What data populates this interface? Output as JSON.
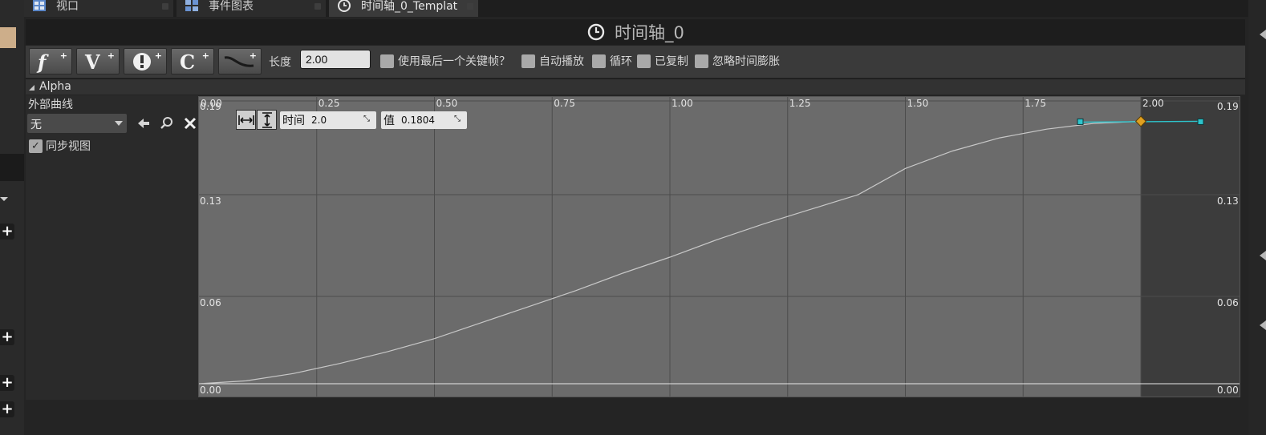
{
  "tabs": [
    {
      "label": "视口",
      "icon": "viewport-grid-icon"
    },
    {
      "label": "事件图表",
      "icon": "event-graph-icon"
    },
    {
      "label": "时间轴_0_Templat",
      "icon": "clock-icon",
      "active": true
    }
  ],
  "panel": {
    "title": "时间轴_0",
    "title_icon": "clock-icon"
  },
  "toolbar": {
    "buttons": [
      {
        "name": "add-float-track",
        "glyph": "f",
        "icon": "float-track-icon"
      },
      {
        "name": "add-vector-track",
        "glyph": "V",
        "icon": "vector-track-icon"
      },
      {
        "name": "add-event-track",
        "glyph": "!",
        "icon": "event-track-icon"
      },
      {
        "name": "add-color-track",
        "glyph": "C",
        "icon": "color-track-icon"
      },
      {
        "name": "add-curve-asset",
        "glyph": "~",
        "icon": "curve-asset-icon"
      }
    ],
    "length_label": "长度",
    "length_value": "2.00",
    "checkboxes": [
      {
        "label": "使用最后一个关键帧？",
        "checked": false
      },
      {
        "label": "自动播放",
        "checked": false
      },
      {
        "label": "循环",
        "checked": false
      },
      {
        "label": "已复制",
        "checked": false
      },
      {
        "label": "忽略时间膨胀",
        "checked": false
      }
    ]
  },
  "track": {
    "name": "Alpha",
    "external_curve_label": "外部曲线",
    "external_curve_value": "无",
    "sync_view_label": "同步视图",
    "sync_view_checked": true
  },
  "curve_editor": {
    "time_label": "时间",
    "time_value": "2.0",
    "value_label": "值",
    "value_value": "0.1804",
    "accent_color": "#2ec4cc",
    "selected_key_color": "#e0a020",
    "curve_color": "#c8c8c8",
    "end_shade_color": "#3c3c3c"
  },
  "chart_data": {
    "type": "line",
    "x_ticks": [
      "0.00",
      "0.25",
      "0.50",
      "0.75",
      "1.00",
      "1.25",
      "1.50",
      "1.75",
      "2.00"
    ],
    "y_ticks": [
      "0.00",
      "0.06",
      "0.13",
      "0.19"
    ],
    "xlim": [
      0,
      2.2
    ],
    "ylim": [
      0,
      0.19
    ],
    "series": [
      {
        "x": [
          0,
          0.1,
          0.2,
          0.3,
          0.4,
          0.5,
          0.6,
          0.7,
          0.8,
          0.9,
          1.0,
          1.1,
          1.2,
          1.3,
          1.4,
          1.5,
          1.6,
          1.7,
          1.8,
          1.9,
          2.0
        ],
        "y": [
          0,
          0.002,
          0.007,
          0.014,
          0.022,
          0.031,
          0.042,
          0.053,
          0.064,
          0.076,
          0.087,
          0.099,
          0.11,
          0.12,
          0.13,
          0.148,
          0.16,
          0.169,
          0.175,
          0.179,
          0.1804
        ]
      }
    ],
    "keys": [
      {
        "x": 2.0,
        "y": 0.1804,
        "selected": true
      }
    ],
    "shaded_after": 2.0
  }
}
